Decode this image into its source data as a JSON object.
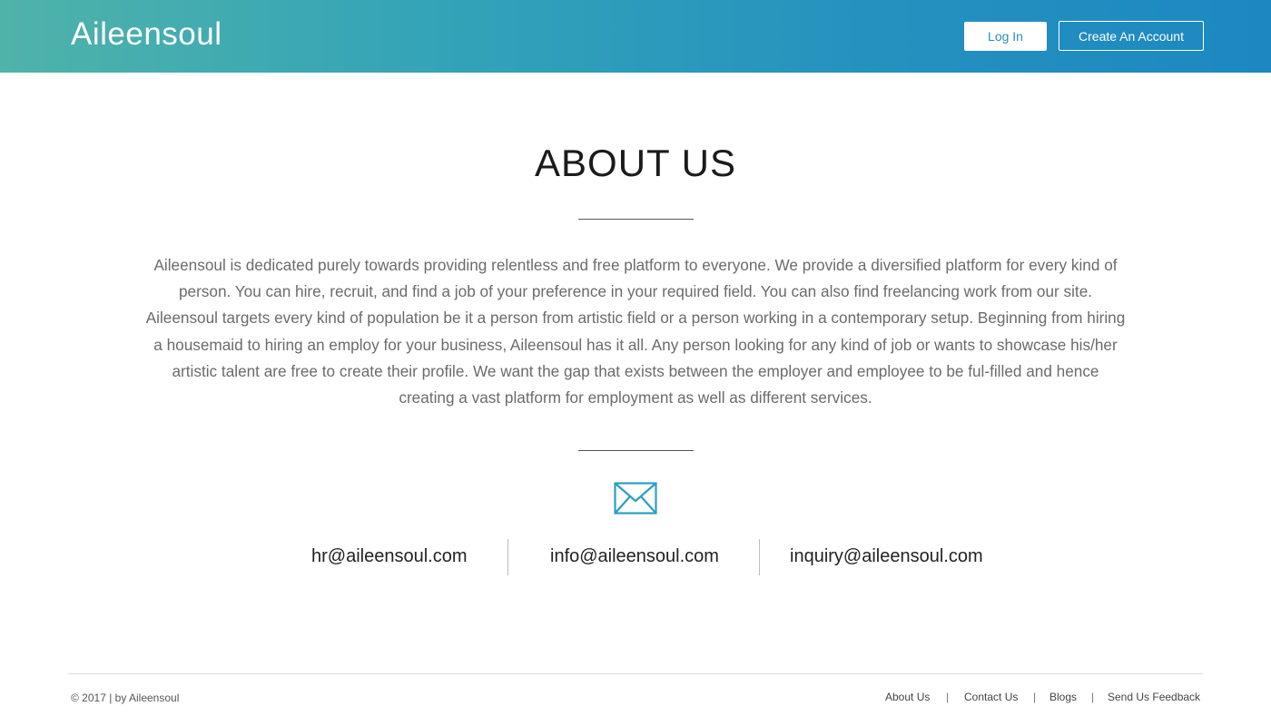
{
  "header": {
    "logo": "Aileensoul",
    "login_label": "Log In",
    "create_account_label": "Create An Account"
  },
  "main": {
    "title": "ABOUT US",
    "paragraph": "Aileensoul is dedicated purely towards providing relentless and free platform to everyone. We provide a diversified platform for every kind of person. You can hire, recruit, and find a job of your preference in your required field. You can also find freelancing work from our site. Aileensoul targets every kind of population be it a person from artistic field or a person working in a contemporary setup. Beginning from hiring a housemaid to hiring an employ for your business, Aileensoul has it all. Any person looking for any kind of job or wants to showcase his/her artistic talent are free to create their profile. We want the gap that exists between the employer and employee to be ful-filled and hence creating a vast platform for employment as well as different services.",
    "contact_icon": "envelope-icon",
    "emails": [
      "hr@aileensoul.com",
      "info@aileensoul.com",
      "inquiry@aileensoul.com"
    ]
  },
  "footer": {
    "copyright": "© 2017 | by Aileensoul",
    "links": [
      "About Us",
      "Contact Us",
      "Blogs",
      "Send Us Feedback"
    ],
    "separator": "|"
  },
  "colors": {
    "header_gradient_start": "#4fb3a9",
    "header_gradient_end": "#1c88c2",
    "icon_accent": "#2b9fc2"
  }
}
